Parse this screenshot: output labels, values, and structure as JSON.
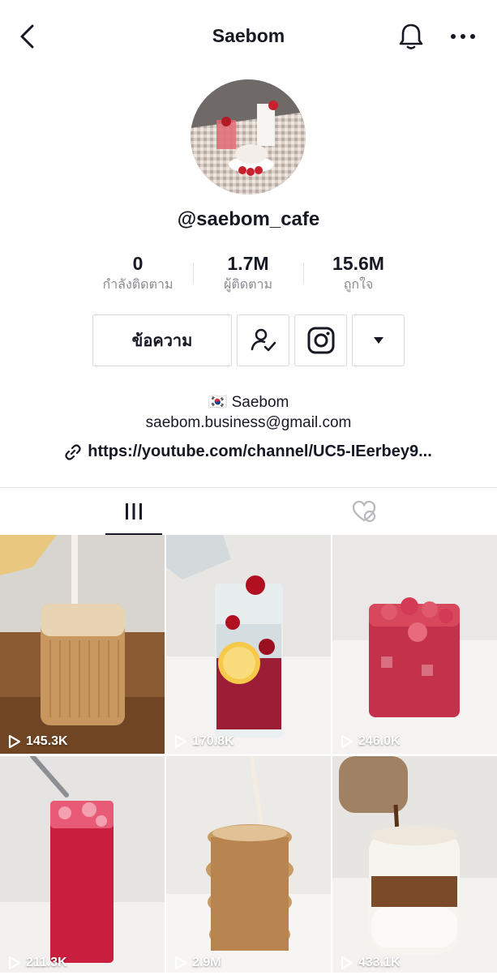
{
  "header": {
    "title": "Saebom"
  },
  "profile": {
    "handle": "@saebom_cafe"
  },
  "stats": [
    {
      "value": "0",
      "label": "กำลังติดตาม"
    },
    {
      "value": "1.7M",
      "label": "ผู้ติดตาม"
    },
    {
      "value": "15.6M",
      "label": "ถูกใจ"
    }
  ],
  "actions": {
    "message_label": "ข้อความ"
  },
  "bio": {
    "name": "🇰🇷 Saebom",
    "email": "saebom.business@gmail.com",
    "link": "https://youtube.com/channel/UC5-IEerbey9..."
  },
  "videos": [
    {
      "views": "145.3K"
    },
    {
      "views": "170.8K"
    },
    {
      "views": "246.0K"
    },
    {
      "views": "211.3K"
    },
    {
      "views": "2.9M"
    },
    {
      "views": "433.1K"
    }
  ]
}
